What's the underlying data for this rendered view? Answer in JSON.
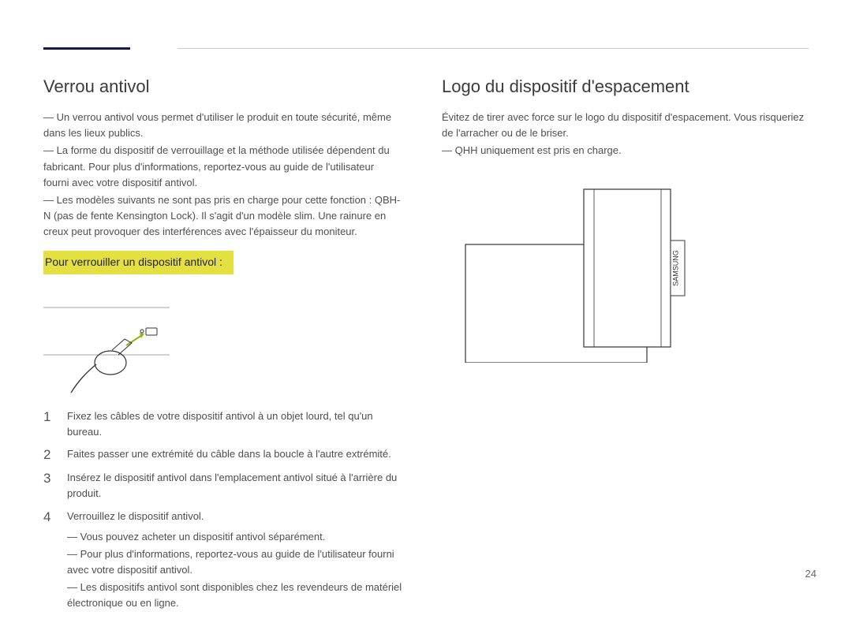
{
  "left": {
    "heading": "Verrou antivol",
    "notes": [
      "Un verrou antivol vous permet d'utiliser le produit en toute sécurité, même dans les lieux publics.",
      "La forme du dispositif de verrouillage et la méthode utilisée dépendent du fabricant. Pour plus d'informations, reportez-vous au guide de l'utilisateur fourni avec votre dispositif antivol.",
      "Les modèles suivants ne sont pas pris en charge pour cette fonction : QBH-N (pas de fente Kensington Lock). Il s'agit d'un modèle slim. Une rainure en creux peut provoquer des interférences avec l'épaisseur du moniteur."
    ],
    "sub_heading": "Pour verrouiller un dispositif antivol :",
    "figure_alt": "Illustration câble antivol inséré dans la fente",
    "steps": [
      "Fixez les câbles de votre dispositif antivol à un objet lourd, tel qu'un bureau.",
      "Faites passer une extrémité du câble dans la boucle à l'autre extrémité.",
      "Insérez le dispositif antivol dans l'emplacement antivol situé à l'arrière du produit.",
      "Verrouillez le dispositif antivol."
    ],
    "post_notes": [
      "Vous pouvez acheter un dispositif antivol séparément.",
      "Pour plus d'informations, reportez-vous au guide de l'utilisateur fourni avec votre dispositif antivol.",
      "Les dispositifs antivol sont disponibles chez les revendeurs de matériel électronique ou en ligne."
    ]
  },
  "right": {
    "heading": "Logo du dispositif d'espacement",
    "body": [
      "Évitez de tirer avec force sur le logo du dispositif d'espacement. Vous risqueriez de l'arracher ou de le briser.",
      "QHH uniquement est pris en charge."
    ],
    "figure_alt": "Illustration du coin du moniteur avec étiquette SAMSUNG",
    "logo_text": "SAMSUNG"
  },
  "page_number": "24"
}
